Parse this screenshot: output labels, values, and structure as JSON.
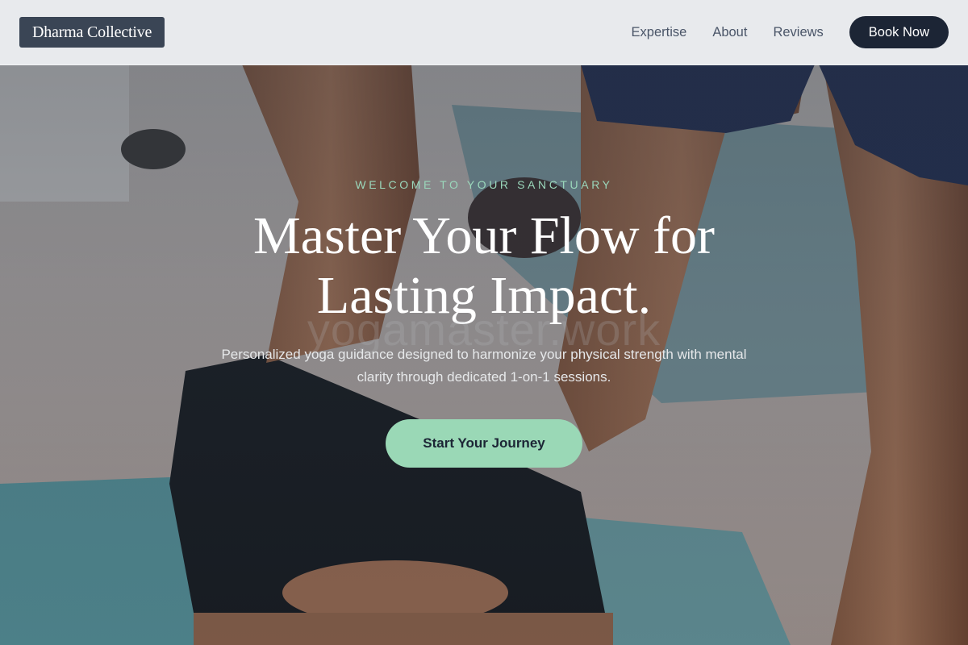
{
  "nav": {
    "logo": "Dharma Collective",
    "links": [
      {
        "label": "Expertise"
      },
      {
        "label": "About"
      },
      {
        "label": "Reviews"
      }
    ],
    "cta_label": "Book Now"
  },
  "hero": {
    "eyebrow": "WELCOME TO YOUR SANCTUARY",
    "headline_line1": "Master Your Flow for",
    "headline_line2": "Lasting Impact.",
    "watermark": "yogamaster.work",
    "subtext": "Personalized yoga guidance designed to harmonize your physical strength with mental clarity through dedicated 1-on-1 sessions.",
    "cta_label": "Start Your Journey",
    "background_image": "yoga-instructor-assisting-student-photo"
  },
  "colors": {
    "nav_bg": "#f0f2f4",
    "logo_bg": "#3a4555",
    "primary_dark": "#1c2535",
    "accent_mint": "#9ad8b6",
    "eyebrow_mint": "#9ad7bb"
  }
}
